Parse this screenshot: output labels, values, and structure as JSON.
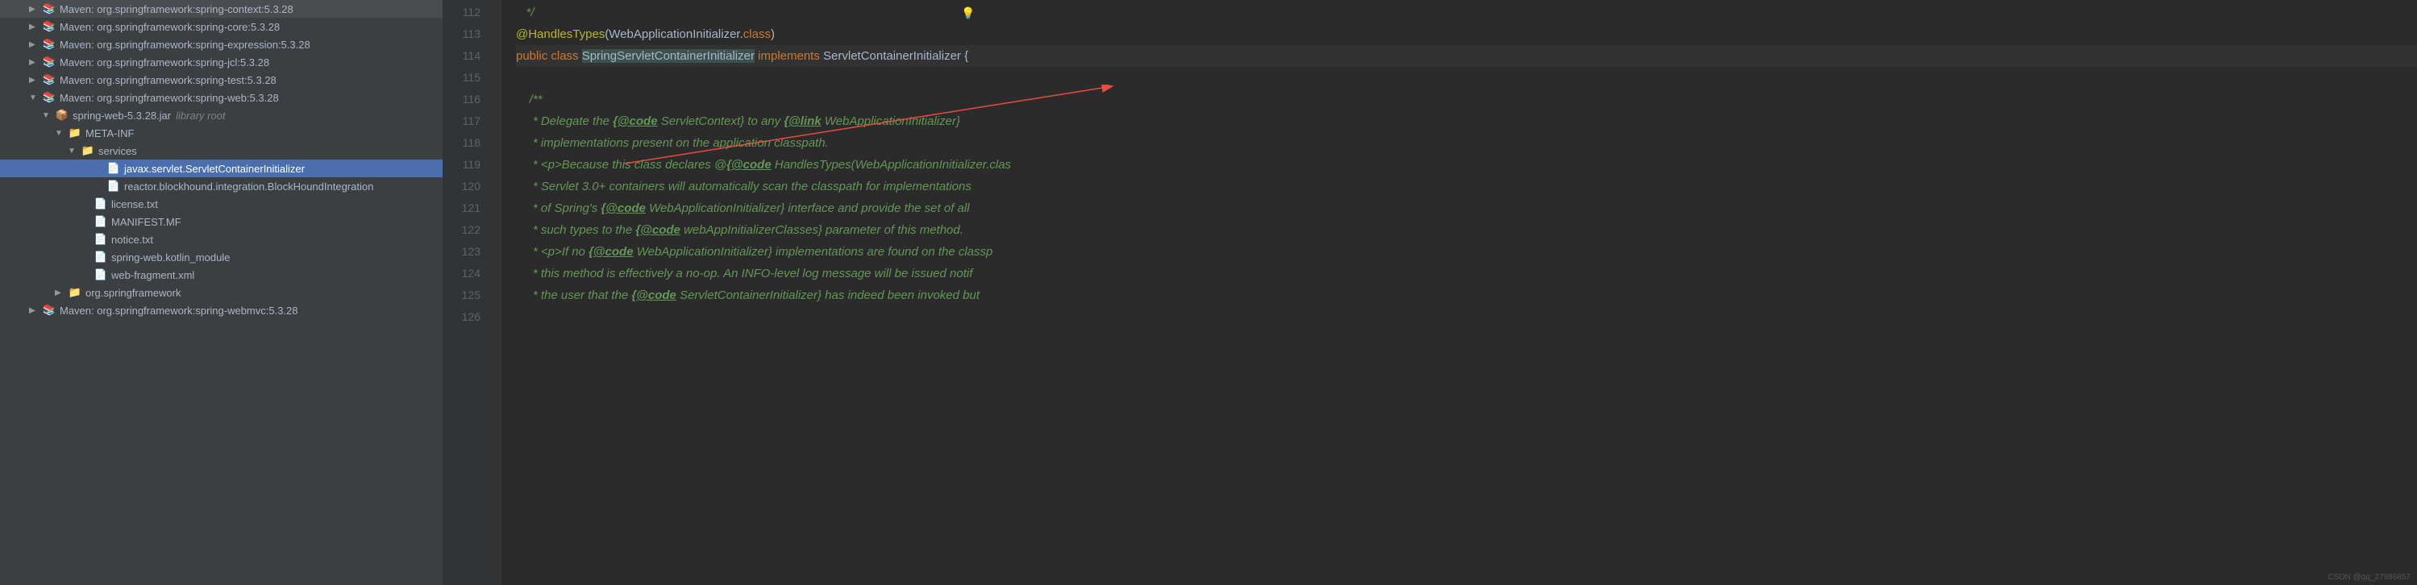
{
  "tree": {
    "items": [
      {
        "label": "Maven: org.springframework:spring-context:5.3.28",
        "icon": "maven",
        "indent": 1,
        "arrow": "right"
      },
      {
        "label": "Maven: org.springframework:spring-core:5.3.28",
        "icon": "maven",
        "indent": 1,
        "arrow": "right"
      },
      {
        "label": "Maven: org.springframework:spring-expression:5.3.28",
        "icon": "maven",
        "indent": 1,
        "arrow": "right"
      },
      {
        "label": "Maven: org.springframework:spring-jcl:5.3.28",
        "icon": "maven",
        "indent": 1,
        "arrow": "right"
      },
      {
        "label": "Maven: org.springframework:spring-test:5.3.28",
        "icon": "maven",
        "indent": 1,
        "arrow": "right"
      },
      {
        "label": "Maven: org.springframework:spring-web:5.3.28",
        "icon": "maven",
        "indent": 1,
        "arrow": "down"
      },
      {
        "label": "spring-web-5.3.28.jar",
        "suffix": "library root",
        "icon": "jar",
        "indent": 2,
        "arrow": "down"
      },
      {
        "label": "META-INF",
        "icon": "folder",
        "indent": 3,
        "arrow": "down"
      },
      {
        "label": "services",
        "icon": "folder",
        "indent": 4,
        "arrow": "down"
      },
      {
        "label": "javax.servlet.ServletContainerInitializer",
        "icon": "file",
        "indent": 6,
        "arrow": "none",
        "selected": true
      },
      {
        "label": "reactor.blockhound.integration.BlockHoundIntegration",
        "icon": "file",
        "indent": 6,
        "arrow": "none"
      },
      {
        "label": "license.txt",
        "icon": "file",
        "indent": 5,
        "arrow": "none"
      },
      {
        "label": "MANIFEST.MF",
        "icon": "file",
        "indent": 5,
        "arrow": "none"
      },
      {
        "label": "notice.txt",
        "icon": "file",
        "indent": 5,
        "arrow": "none"
      },
      {
        "label": "spring-web.kotlin_module",
        "icon": "file",
        "indent": 5,
        "arrow": "none"
      },
      {
        "label": "web-fragment.xml",
        "icon": "xml",
        "indent": 5,
        "arrow": "none"
      },
      {
        "label": "org.springframework",
        "icon": "folder",
        "indent": 3,
        "arrow": "right"
      },
      {
        "label": "Maven: org.springframework:spring-webmvc:5.3.28",
        "icon": "maven",
        "indent": 1,
        "arrow": "right"
      }
    ]
  },
  "editor": {
    "lines": [
      "112",
      "113",
      "114",
      "115",
      "116",
      "117",
      "118",
      "119",
      "120",
      "121",
      "122",
      "123",
      "124",
      "125",
      "126"
    ],
    "l112": "*/",
    "l113_anno": "@HandlesTypes",
    "l113_open": "(",
    "l113_cls": "WebApplicationInitializer",
    "l113_dot": ".",
    "l113_class": "class",
    "l113_close": ")",
    "l114_public": "public ",
    "l114_class": "class ",
    "l114_name": "SpringServletContainerInitializer",
    "l114_impl": " implements ",
    "l114_iface": "ServletContainerInitializer {",
    "l115": "",
    "l116": "/**",
    "l117_a": " * Delegate the ",
    "l117_b": "{",
    "l117_c": "@code",
    "l117_d": " ServletContext}",
    "l117_e": " to any ",
    "l117_f": "{",
    "l117_g": "@link",
    "l117_h": " WebApplicationInitializer}",
    "l118": " * implementations present on the application classpath.",
    "l119_a": " * <p>Because this class declares @",
    "l119_b": "{",
    "l119_c": "@code",
    "l119_d": " HandlesTypes(WebApplicationInitializer.clas",
    "l120": " * Servlet 3.0+ containers will automatically scan the classpath for implementations",
    "l121_a": " * of Spring's ",
    "l121_b": "{",
    "l121_c": "@code",
    "l121_d": " WebApplicationInitializer}",
    "l121_e": " interface and provide the set of all",
    "l122_a": " * such types to the ",
    "l122_b": "{",
    "l122_c": "@code",
    "l122_d": " webAppInitializerClasses}",
    "l122_e": " parameter of this method.",
    "l123_a": " * <p>If no ",
    "l123_b": "{",
    "l123_c": "@code",
    "l123_d": " WebApplicationInitializer}",
    "l123_e": " implementations are found on the classp",
    "l124": " * this method is effectively a no-op. An INFO-level log message will be issued notif",
    "l125_a": " * the user that the ",
    "l125_b": "{",
    "l125_c": "@code",
    "l125_d": " ServletContainerInitializer}",
    "l125_e": " has indeed been invoked but"
  },
  "watermark": "CSDN @qq_27986857"
}
